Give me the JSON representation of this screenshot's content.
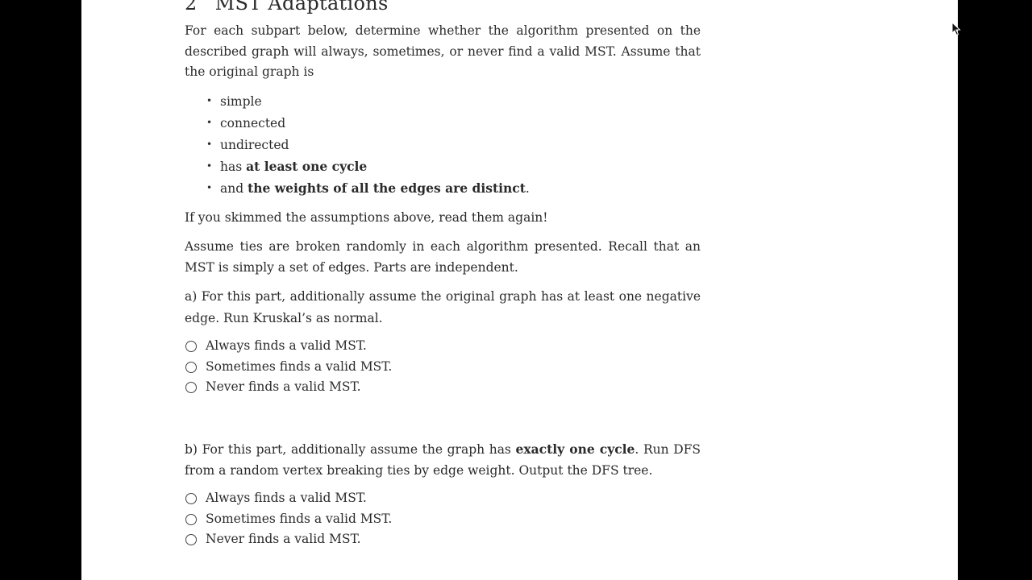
{
  "section": {
    "number": "2",
    "title": "MST Adaptations"
  },
  "intro": "For each subpart below, determine whether the algorithm presented on the described graph will always, sometimes, or never find a valid MST. Assume that the original graph is",
  "assumptions": [
    {
      "prefix": "",
      "bold": "",
      "plain": "simple",
      "suffix": ""
    },
    {
      "prefix": "",
      "bold": "",
      "plain": "connected",
      "suffix": ""
    },
    {
      "prefix": "",
      "bold": "",
      "plain": "undirected",
      "suffix": ""
    },
    {
      "prefix": "has ",
      "bold": "at least one cycle",
      "plain": "",
      "suffix": ""
    },
    {
      "prefix": "and ",
      "bold": "the weights of all the edges are distinct",
      "plain": "",
      "suffix": "."
    }
  ],
  "skim_note": "If you skimmed the assumptions above, read them again!",
  "ties_note": "Assume ties are broken randomly in each algorithm presented. Recall that an MST is simply a set of edges. Parts are independent.",
  "parts": [
    {
      "label": "a)",
      "before": "For this part, additionally assume the original graph has at least one negative edge. Run Kruskal’s as normal.",
      "bold": "",
      "after": "",
      "options": [
        "Always finds a valid MST.",
        "Sometimes finds a valid MST.",
        "Never finds a valid MST."
      ]
    },
    {
      "label": "b)",
      "before": "For this part, additionally assume the graph has ",
      "bold": "exactly one cycle",
      "after": ". Run DFS from a random vertex breaking ties by edge weight. Output the DFS tree.",
      "options": [
        "Always finds a valid MST.",
        "Sometimes finds a valid MST.",
        "Never finds a valid MST."
      ]
    }
  ],
  "bullet_char": "•",
  "colors": {
    "background": "#000000",
    "page": "#ffffff",
    "text": "#2b2b2b"
  }
}
